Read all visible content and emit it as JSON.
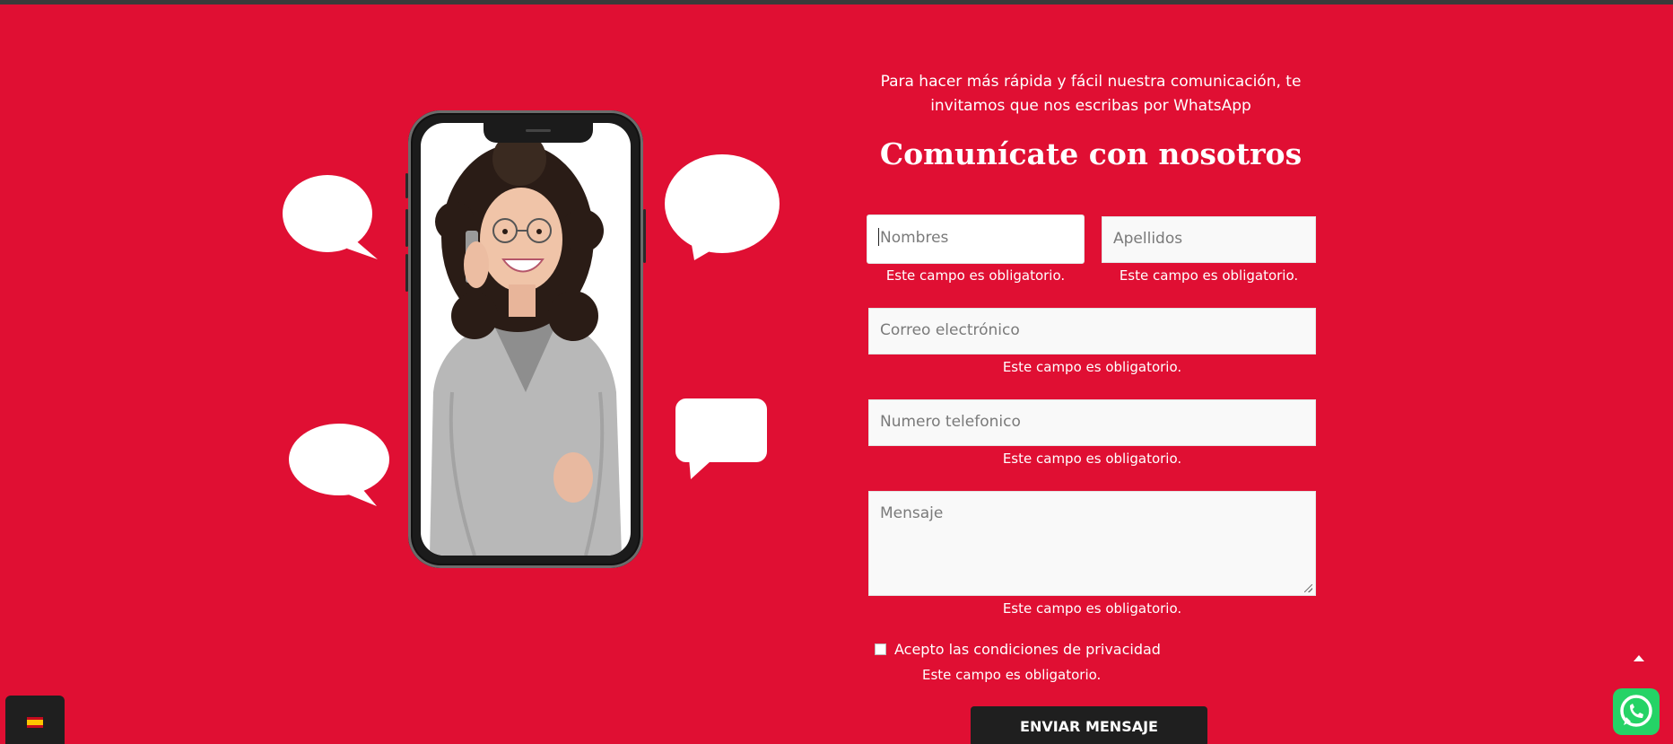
{
  "intro": {
    "line1": "Para hacer más rápida y fácil nuestra comunicación, te",
    "line2": "invitamos que nos escribas por WhatsApp"
  },
  "heading": "Comunícate con nosotros",
  "form": {
    "first_name_placeholder": "Nombres",
    "last_name_placeholder": "Apellidos",
    "email_placeholder": "Correo electrónico",
    "phone_placeholder": "Numero telefonico",
    "message_placeholder": "Mensaje",
    "required_error": "Este campo es obligatorio.",
    "privacy_label": "Acepto las condiciones de privacidad",
    "privacy_checked": false,
    "submit_label": "ENVIAR MENSAJE"
  },
  "widgets": {
    "language_flag": "spain-flag-icon",
    "scroll_top_icon": "arrow-up-icon",
    "whatsapp_icon": "whatsapp-icon"
  },
  "colors": {
    "background": "#e00f33",
    "button": "#1f1f1f",
    "whatsapp": "#25d366"
  }
}
